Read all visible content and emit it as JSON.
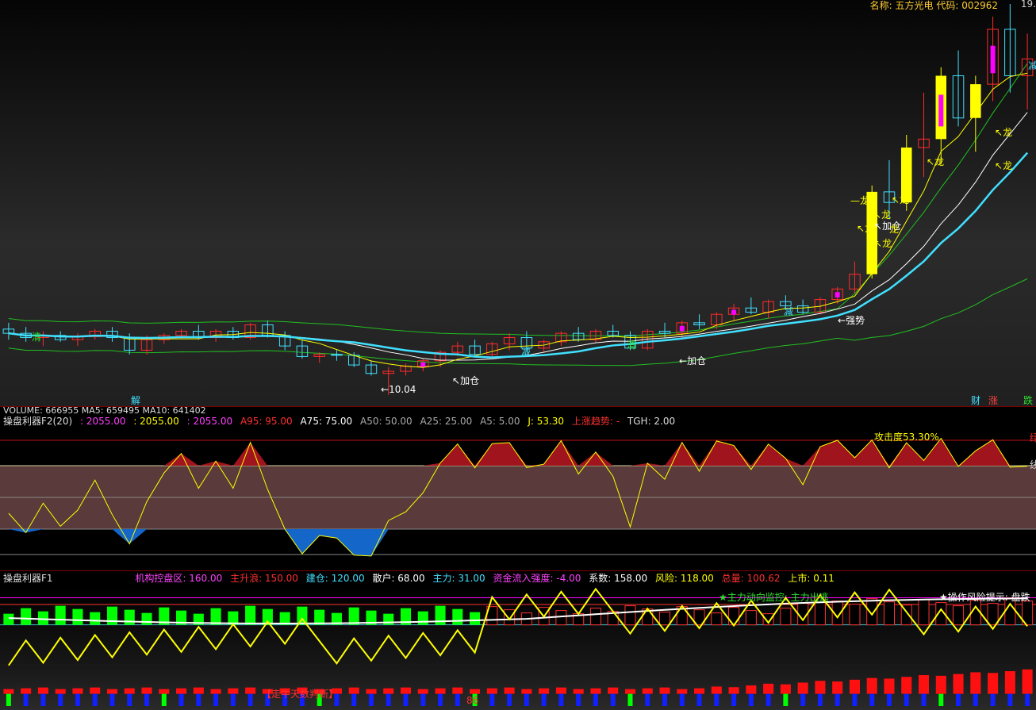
{
  "header": {
    "name_label": "名称:",
    "name": "五方光电",
    "code_label": "代码:",
    "code": "002962",
    "price_high": "19."
  },
  "colors": {
    "bg_top": "#2b2b2b",
    "bull": "#ff2a2a",
    "bear": "#40e0ff",
    "yellow": "#ffff00",
    "magenta": "#ff00ff",
    "green": "#00ff00",
    "white": "#ffffff",
    "mid_band": "#5a3a3a",
    "attack_fill": "#a0141e",
    "weak_fill": "#1466c8"
  },
  "main_labels": {
    "signals": [
      "清",
      "减",
      "清",
      "减",
      "解"
    ],
    "add_position": "加仓",
    "strong": "强势",
    "dragon": "龙",
    "low_price": "10.04",
    "side_tags": [
      "财",
      "涨",
      "跌"
    ],
    "right_edge": "减"
  },
  "volume_bar": {
    "text": "VOLUME: 666955  MA5: 659495  MA10: 641402"
  },
  "f2_bar": {
    "title": "操盘利器F2(20)",
    "v1": ": 2055.00",
    "v2": ": 2055.00",
    "v3": ": 2055.00",
    "a95": "A95: 95.00",
    "a75": "A75: 75.00",
    "a50": "A50: 50.00",
    "a25": "A25: 25.00",
    "a5": "A5: 5.00",
    "j": "J: 53.30",
    "trend": "上涨趋势: -",
    "tgh": "TGH: 2.00"
  },
  "f2_labels": {
    "attack": "攻击度53.30%",
    "right_top": "绿",
    "right_mid": "线"
  },
  "f1_bar": {
    "title": "操盘利器F1",
    "inst": "机构控盘区: 160.00",
    "main_up": "主升浪: 150.00",
    "build": "建仓: 120.00",
    "retail": "散户: 68.00",
    "main": "主力: 31.00",
    "inflow": "资金流入强度: -4.00",
    "coef": "系数: 158.00",
    "risk": "风险: 118.00",
    "total": "总量: 100.62",
    "listed": "上市: 0.11"
  },
  "f1_labels": {
    "monitor": "★主力动向监控: 主力出逃",
    "risk_tip": "★操作风险提示: 盘跌",
    "bull_count": "【走牛天数判断】",
    "number": "86"
  },
  "chart_data": {
    "type": "candlestick",
    "title": "",
    "candles": [
      [
        11.6,
        11.75,
        11.35,
        11.5
      ],
      [
        11.5,
        11.65,
        11.3,
        11.4
      ],
      [
        11.4,
        11.55,
        11.2,
        11.45
      ],
      [
        11.45,
        11.55,
        11.3,
        11.35
      ],
      [
        11.35,
        11.5,
        11.2,
        11.42
      ],
      [
        11.42,
        11.6,
        11.35,
        11.55
      ],
      [
        11.55,
        11.65,
        11.3,
        11.4
      ],
      [
        11.4,
        11.5,
        11.0,
        11.1
      ],
      [
        11.1,
        11.45,
        11.0,
        11.35
      ],
      [
        11.35,
        11.5,
        11.25,
        11.45
      ],
      [
        11.45,
        11.6,
        11.38,
        11.55
      ],
      [
        11.55,
        11.7,
        11.35,
        11.4
      ],
      [
        11.4,
        11.6,
        11.3,
        11.55
      ],
      [
        11.55,
        11.65,
        11.35,
        11.4
      ],
      [
        11.4,
        11.75,
        11.35,
        11.7
      ],
      [
        11.7,
        11.8,
        11.4,
        11.45
      ],
      [
        11.45,
        11.55,
        11.1,
        11.2
      ],
      [
        11.2,
        11.35,
        10.9,
        10.95
      ],
      [
        10.95,
        11.05,
        10.8,
        11.0
      ],
      [
        11.0,
        11.1,
        10.85,
        10.98
      ],
      [
        10.98,
        11.05,
        10.7,
        10.75
      ],
      [
        10.75,
        10.85,
        10.5,
        10.55
      ],
      [
        10.55,
        10.7,
        10.04,
        10.6
      ],
      [
        10.6,
        10.78,
        10.5,
        10.72
      ],
      [
        10.72,
        10.9,
        10.6,
        10.85
      ],
      [
        10.85,
        11.1,
        10.7,
        11.05
      ],
      [
        11.05,
        11.3,
        10.95,
        11.2
      ],
      [
        11.2,
        11.35,
        10.95,
        11.0
      ],
      [
        11.0,
        11.3,
        10.95,
        11.25
      ],
      [
        11.25,
        11.5,
        11.1,
        11.4
      ],
      [
        11.4,
        11.55,
        11.1,
        11.15
      ],
      [
        11.15,
        11.35,
        11.05,
        11.3
      ],
      [
        11.3,
        11.55,
        11.2,
        11.5
      ],
      [
        11.5,
        11.65,
        11.3,
        11.35
      ],
      [
        11.35,
        11.6,
        11.28,
        11.55
      ],
      [
        11.55,
        11.7,
        11.4,
        11.45
      ],
      [
        11.45,
        11.55,
        11.1,
        11.15
      ],
      [
        11.15,
        11.6,
        11.1,
        11.55
      ],
      [
        11.55,
        11.75,
        11.4,
        11.5
      ],
      [
        11.5,
        11.8,
        11.4,
        11.75
      ],
      [
        11.75,
        11.95,
        11.6,
        11.7
      ],
      [
        11.7,
        12.0,
        11.6,
        11.95
      ],
      [
        11.95,
        12.2,
        11.8,
        12.1
      ],
      [
        12.1,
        12.35,
        11.95,
        12.0
      ],
      [
        12.0,
        12.3,
        11.85,
        12.25
      ],
      [
        12.25,
        12.4,
        12.05,
        12.15
      ],
      [
        12.15,
        12.3,
        11.95,
        12.0
      ],
      [
        12.0,
        12.35,
        11.95,
        12.3
      ],
      [
        12.3,
        12.6,
        12.2,
        12.55
      ],
      [
        12.55,
        13.2,
        12.45,
        12.9
      ],
      [
        12.9,
        15.0,
        12.8,
        14.85
      ],
      [
        14.85,
        15.6,
        14.2,
        14.6
      ],
      [
        14.6,
        16.2,
        14.4,
        15.9
      ],
      [
        15.9,
        17.2,
        15.2,
        16.1
      ],
      [
        16.1,
        17.8,
        15.5,
        17.6
      ],
      [
        17.6,
        18.2,
        16.4,
        16.6
      ],
      [
        16.6,
        17.6,
        15.8,
        17.4
      ],
      [
        17.4,
        19.0,
        17.0,
        18.7
      ],
      [
        18.7,
        19.3,
        17.2,
        17.6
      ],
      [
        17.6,
        18.6,
        16.8,
        18.0
      ]
    ],
    "y_range": [
      10.0,
      19.3
    ]
  }
}
